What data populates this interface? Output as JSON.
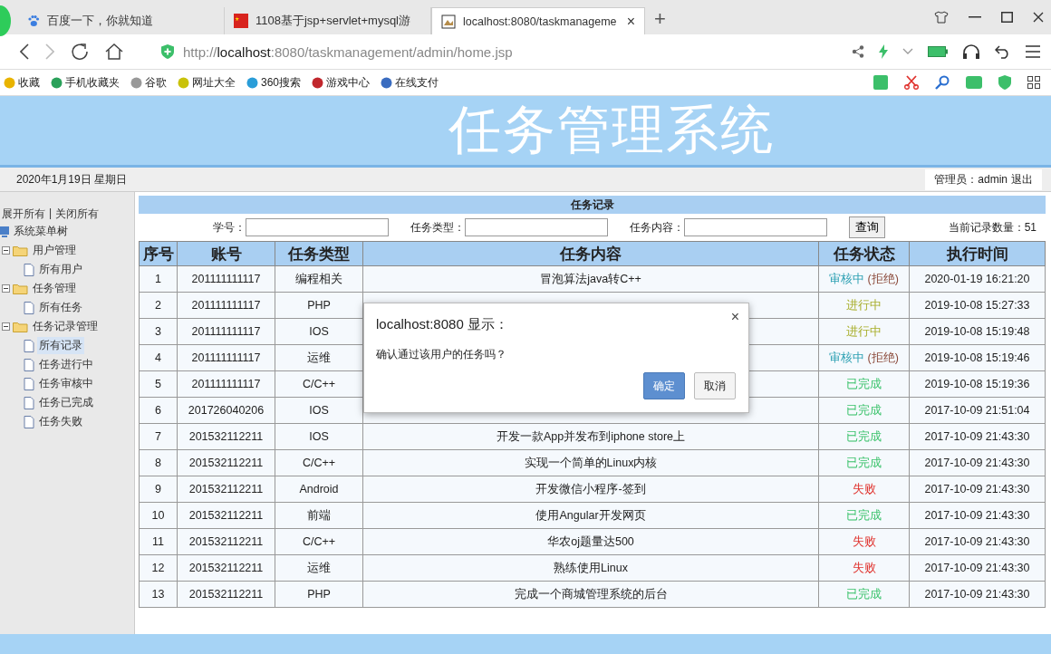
{
  "browser": {
    "tabs": [
      {
        "title": "百度一下，你就知道",
        "selected": false
      },
      {
        "title": "1108基于jsp+servlet+mysql游",
        "selected": false
      },
      {
        "title": "localhost:8080/taskmanageme",
        "selected": true
      }
    ],
    "new_tab": "+",
    "close_tab": "×",
    "url": {
      "scheme": "http://",
      "host": "localhost",
      "rest": ":8080/taskmanagement/admin/home.jsp"
    },
    "bookmarks": [
      "收藏",
      "手机收藏夹",
      "谷歌",
      "网址大全",
      "360搜索",
      "游戏中心",
      "在线支付"
    ]
  },
  "header": {
    "title": "任务管理系统"
  },
  "topbar": {
    "date": "2020年1月19日 星期日",
    "admin": "管理员：admin",
    "logout": "退出"
  },
  "sidebar": {
    "expand_all": "展开所有",
    "collapse_all": "关闭所有",
    "separator": "|",
    "tree": {
      "label": "系统菜单树",
      "children": [
        {
          "label": "用户管理",
          "expanded": true,
          "children": [
            {
              "label": "所有用户",
              "selected": false
            }
          ]
        },
        {
          "label": "任务管理",
          "expanded": true,
          "children": [
            {
              "label": "所有任务",
              "selected": false
            }
          ]
        },
        {
          "label": "任务记录管理",
          "expanded": true,
          "children": [
            {
              "label": "所有记录",
              "selected": true
            },
            {
              "label": "任务进行中",
              "selected": false
            },
            {
              "label": "任务审核中",
              "selected": false
            },
            {
              "label": "任务已完成",
              "selected": false
            },
            {
              "label": "任务失败",
              "selected": false
            }
          ]
        }
      ]
    }
  },
  "panel": {
    "title": "任务记录",
    "filters": [
      {
        "label": "学号："
      },
      {
        "label": "任务类型："
      },
      {
        "label": "任务内容："
      }
    ],
    "search_button": "查询",
    "count": "当前记录数量：51"
  },
  "table": {
    "columns": [
      "序号",
      "账号",
      "任务类型",
      "任务内容",
      "任务状态",
      "执行时间"
    ],
    "rows": [
      {
        "no": "1",
        "account": "201111111117",
        "type": "编程相关",
        "content": "冒泡算法java转C++",
        "status": {
          "kind": "review",
          "label": "审核中",
          "note": "(拒绝)"
        },
        "time": "2020-01-19 16:21:20"
      },
      {
        "no": "2",
        "account": "201111111117",
        "type": "PHP",
        "status": {
          "kind": "running",
          "label": "进行中"
        },
        "time": "2019-10-08 15:27:33"
      },
      {
        "no": "3",
        "account": "201111111117",
        "type": "IOS",
        "status": {
          "kind": "running",
          "label": "进行中"
        },
        "time": "2019-10-08 15:19:48"
      },
      {
        "no": "4",
        "account": "201111111117",
        "type": "运维",
        "status": {
          "kind": "review",
          "label": "审核中",
          "note": "(拒绝)"
        },
        "time": "2019-10-08 15:19:46"
      },
      {
        "no": "5",
        "account": "201111111117",
        "type": "C/C++",
        "status": {
          "kind": "done",
          "label": "已完成"
        },
        "time": "2019-10-08 15:19:36"
      },
      {
        "no": "6",
        "account": "201726040206",
        "type": "IOS",
        "status": {
          "kind": "done",
          "label": "已完成"
        },
        "time": "2017-10-09 21:51:04"
      },
      {
        "no": "7",
        "account": "201532112211",
        "type": "IOS",
        "content": "开发一款App并发布到iphone store上",
        "status": {
          "kind": "done",
          "label": "已完成"
        },
        "time": "2017-10-09 21:43:30"
      },
      {
        "no": "8",
        "account": "201532112211",
        "type": "C/C++",
        "content": "实现一个简单的Linux内核",
        "status": {
          "kind": "done",
          "label": "已完成"
        },
        "time": "2017-10-09 21:43:30"
      },
      {
        "no": "9",
        "account": "201532112211",
        "type": "Android",
        "content": "开发微信小程序-签到",
        "status": {
          "kind": "failed",
          "label": "失败"
        },
        "time": "2017-10-09 21:43:30"
      },
      {
        "no": "10",
        "account": "201532112211",
        "type": "前端",
        "content": "使用Angular开发网页",
        "status": {
          "kind": "done",
          "label": "已完成"
        },
        "time": "2017-10-09 21:43:30"
      },
      {
        "no": "11",
        "account": "201532112211",
        "type": "C/C++",
        "content": "华农oj题量达500",
        "status": {
          "kind": "failed",
          "label": "失败"
        },
        "time": "2017-10-09 21:43:30"
      },
      {
        "no": "12",
        "account": "201532112211",
        "type": "运维",
        "content": "熟练使用Linux",
        "status": {
          "kind": "failed",
          "label": "失败"
        },
        "time": "2017-10-09 21:43:30"
      },
      {
        "no": "13",
        "account": "201532112211",
        "type": "PHP",
        "content": "完成一个商城管理系统的后台",
        "status": {
          "kind": "done",
          "label": "已完成"
        },
        "time": "2017-10-09 21:43:30"
      }
    ]
  },
  "dialog": {
    "title": "localhost:8080 显示：",
    "message": "确认通过该用户的任务吗？",
    "close": "×",
    "buttons": [
      {
        "label": "确定",
        "kind": "primary"
      },
      {
        "label": "取消",
        "kind": "default"
      }
    ]
  }
}
